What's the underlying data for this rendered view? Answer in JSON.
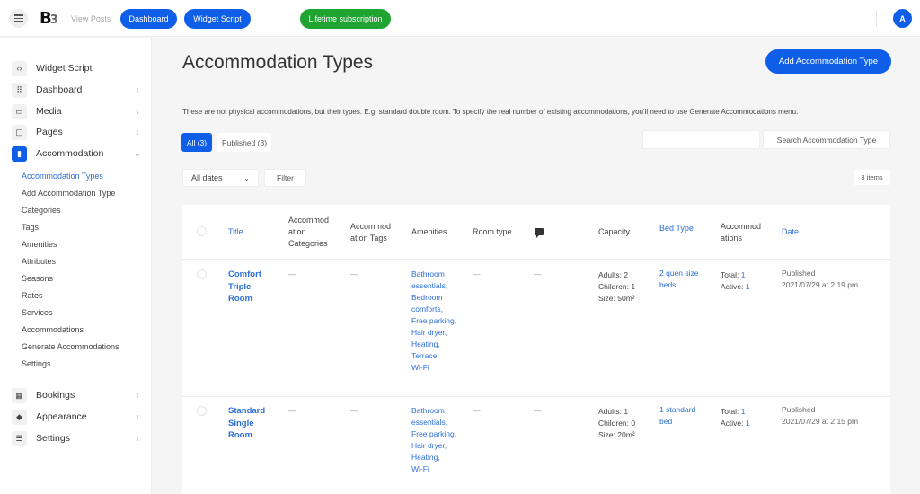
{
  "topbar": {
    "logo": "B",
    "logo_suffix": "3",
    "view_posts": "View Posts",
    "dashboard": "Dashboard",
    "widget_script": "Widget Script",
    "lifetime": "Lifetime subscription",
    "avatar_initial": "A",
    "colors": {
      "primary": "#0f5ee8",
      "success": "#1fa331"
    }
  },
  "sidebar": {
    "items": [
      {
        "label": "Widget Script",
        "icon": "code-icon",
        "chevron": ""
      },
      {
        "label": "Dashboard",
        "icon": "grid-icon",
        "chevron": "‹"
      },
      {
        "label": "Media",
        "icon": "image-icon",
        "chevron": "‹"
      },
      {
        "label": "Pages",
        "icon": "pages-icon",
        "chevron": "‹"
      },
      {
        "label": "Accommodation",
        "icon": "building-icon",
        "chevron": "⌄"
      }
    ],
    "submenu": [
      "Accommodation Types",
      "Add Accommodation Type",
      "Categories",
      "Tags",
      "Amenities",
      "Attributes",
      "Seasons",
      "Rates",
      "Services",
      "Accommodations",
      "Generate Accommodations",
      "Settings"
    ],
    "bottom_items": [
      {
        "label": "Bookings",
        "icon": "calendar-icon",
        "chevron": "‹"
      },
      {
        "label": "Appearance",
        "icon": "paint-bucket-icon",
        "chevron": "‹"
      },
      {
        "label": "Settings",
        "icon": "sliders-icon",
        "chevron": "‹"
      }
    ]
  },
  "main": {
    "title": "Accommodation Types",
    "add_button": "Add Accommodation Type",
    "description": "These are not physical accommodations, but their types. E.g. standard double room. To specify the real number of existing accommodations, you'll need to use Generate Accommodations menu.",
    "filters": {
      "all": "All (3)",
      "published": "Published (3)"
    },
    "search": {
      "value": "",
      "placeholder": "",
      "button": "Search Accommodation Type"
    },
    "dates_select": "All dates",
    "filter_button": "Filter",
    "items_count": "3 items"
  },
  "table": {
    "headers": {
      "title": "Title",
      "categories": "Accommod ation Categories",
      "tags": "Accommod ation Tags",
      "amenities": "Amenities",
      "room_type": "Room type",
      "capacity": "Capacity",
      "bed_type": "Bed Type",
      "accommodations": "Accommod ations",
      "date": "Date"
    },
    "rows": [
      {
        "title": "Comfort Triple Room",
        "categories": "—",
        "tags": "—",
        "amenities": [
          "Bathroom essentials,",
          "Bedroom comforts,",
          "Free parking,",
          "Hair dryer,",
          "Heating,",
          "Terrace,",
          "Wi-Fi"
        ],
        "room_type": "—",
        "comments": "—",
        "capacity": [
          "Adults: 2",
          "Children: 1",
          "Size: 50m²"
        ],
        "bed_type": "2 quen size beds",
        "total_label": "Total:",
        "total": "1",
        "active_label": "Active:",
        "active": "1",
        "status": "Published",
        "date": "2021/07/29 at 2:19 pm"
      },
      {
        "title": "Standard Single Room",
        "categories": "—",
        "tags": "—",
        "amenities": [
          "Bathroom essentials,",
          "Free parking,",
          "Hair dryer,",
          "Heating,",
          "Wi-Fi"
        ],
        "room_type": "—",
        "comments": "—",
        "capacity": [
          "Adults: 1",
          "Children: 0",
          "Size: 20m²"
        ],
        "bed_type": "1 standard bed",
        "total_label": "Total:",
        "total": "1",
        "active_label": "Active:",
        "active": "1",
        "status": "Published",
        "date": "2021/07/29 at 2:15 pm"
      }
    ]
  }
}
